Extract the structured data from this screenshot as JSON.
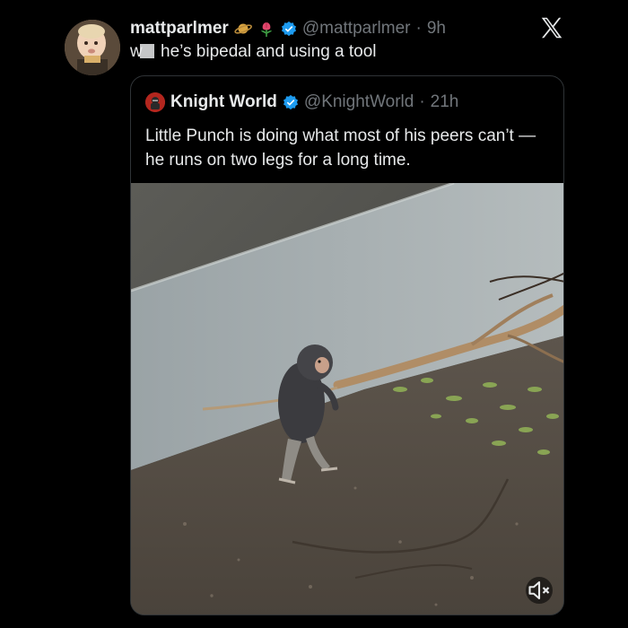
{
  "tweet": {
    "display_name": "mattparlmer",
    "handle": "@mattparlmer",
    "separator": "·",
    "time": "9h",
    "reply_prefix": "w",
    "reply_text": " he’s bipedal and using a tool",
    "icons": [
      "avatar",
      "saturn-emoji-icon",
      "tulip-emoji-icon",
      "verified-badge-icon",
      "x-logo-icon"
    ]
  },
  "quoted": {
    "display_name": "Knight World",
    "handle": "@KnightWorld",
    "separator": "·",
    "time": "21h",
    "text": "Little Punch is doing what most of his peers can’t — he runs on two legs for a long time.",
    "media": {
      "description_icon": "video-thumbnail",
      "mute_icon": "speaker-muted-icon"
    }
  },
  "colors": {
    "background": "#000000",
    "text": "#e7e9ea",
    "secondary": "#71767b",
    "verified": "#1d9bf0",
    "border": "#2f3336"
  }
}
